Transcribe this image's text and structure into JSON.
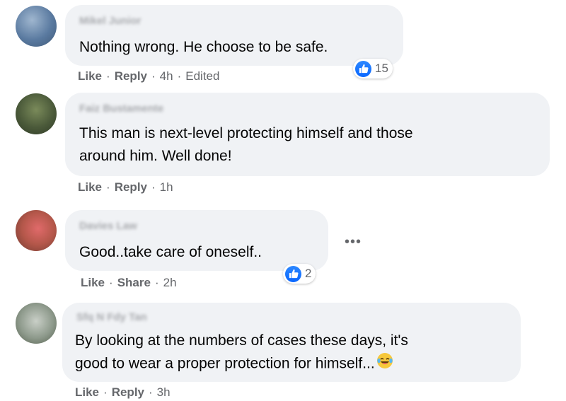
{
  "comments": [
    {
      "author": "Mikel Junior",
      "text": "Nothing wrong. He choose to be safe.",
      "actions": {
        "like": "Like",
        "reply": "Reply",
        "time": "4h",
        "edited": "Edited"
      },
      "reaction": {
        "icon": "like-icon",
        "count": "15"
      }
    },
    {
      "author": "Faiz Bustamente",
      "text_lines": [
        "This man is next-level protecting himself and those",
        "around him. Well done!"
      ],
      "actions": {
        "like": "Like",
        "reply": "Reply",
        "time": "1h"
      }
    },
    {
      "author": "Davies Law",
      "text": "Good..take care of oneself..",
      "actions": {
        "like": "Like",
        "share": "Share",
        "time": "2h"
      },
      "reaction": {
        "icon": "like-icon",
        "count": "2"
      },
      "more_label": "•••"
    },
    {
      "author": "Sfq N Fdy Tan",
      "text_lines": [
        "By looking at the numbers of cases these days, it's",
        "good to wear a proper protection for himself..."
      ],
      "emoji": "laughing-tears-emoji",
      "actions": {
        "like": "Like",
        "reply": "Reply",
        "time": "3h"
      }
    }
  ],
  "colors": {
    "bubble": "#f0f2f5",
    "secondary_text": "#65676b",
    "like_blue": "#0866ff"
  }
}
